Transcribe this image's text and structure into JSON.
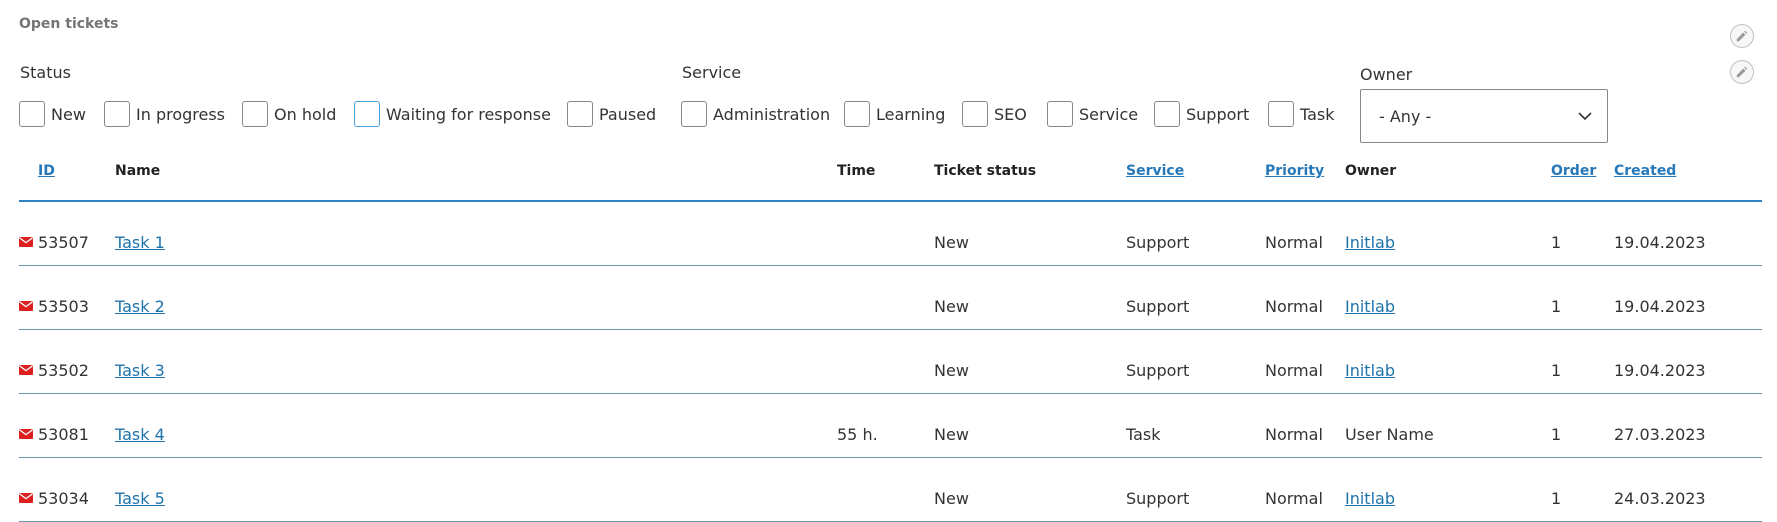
{
  "block": {
    "title": "Open tickets"
  },
  "filters": {
    "status_label": "Status",
    "service_label": "Service",
    "owner_label": "Owner",
    "owner_value": "- Any -",
    "status_options": [
      "New",
      "In progress",
      "On hold",
      "Waiting for response",
      "Paused"
    ],
    "service_options": [
      "Administration",
      "Learning",
      "SEO",
      "Service",
      "Support",
      "Task"
    ]
  },
  "table": {
    "headers": {
      "id": "ID",
      "name": "Name",
      "time": "Time",
      "ticket_status": "Ticket status",
      "service": "Service",
      "priority": "Priority",
      "owner": "Owner",
      "order": "Order",
      "created": "Created"
    },
    "rows": [
      {
        "id": "53507",
        "name": "Task 1",
        "time": "",
        "status": "New",
        "service": "Support",
        "priority": "Normal",
        "owner": "Initlab",
        "order": "1",
        "created": "19.04.2023"
      },
      {
        "id": "53503",
        "name": "Task 2",
        "time": "",
        "status": "New",
        "service": "Support",
        "priority": "Normal",
        "owner": "Initlab",
        "order": "1",
        "created": "19.04.2023"
      },
      {
        "id": "53502",
        "name": "Task 3",
        "time": "",
        "status": "New",
        "service": "Support",
        "priority": "Normal",
        "owner": "Initlab",
        "order": "1",
        "created": "19.04.2023"
      },
      {
        "id": "53081",
        "name": "Task 4",
        "time": "55 h.",
        "status": "New",
        "service": "Task",
        "priority": "Normal",
        "owner": "User Name",
        "order": "1",
        "created": "27.03.2023"
      },
      {
        "id": "53034",
        "name": "Task 5",
        "time": "",
        "status": "New",
        "service": "Support",
        "priority": "Normal",
        "owner": "Initlab",
        "order": "1",
        "created": "24.03.2023"
      }
    ]
  },
  "icons": {
    "edit": "pencil-icon",
    "mail": "envelope-icon",
    "dropdown": "chevron-down-icon"
  },
  "colors": {
    "link": "#1f73ab",
    "header_border": "#2f82c2",
    "mail_icon": "#e02020"
  }
}
